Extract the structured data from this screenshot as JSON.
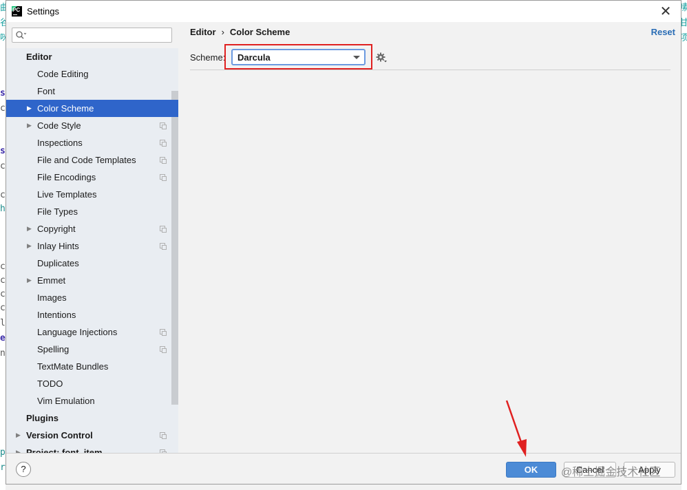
{
  "window": {
    "title": "Settings"
  },
  "sidebar": {
    "search_placeholder": "",
    "items": [
      {
        "label": "Editor",
        "level": 0,
        "bold": true,
        "arrow": false,
        "copy": false,
        "selected": false
      },
      {
        "label": "Code Editing",
        "level": 1,
        "arrow": false,
        "copy": false,
        "selected": false
      },
      {
        "label": "Font",
        "level": 1,
        "arrow": false,
        "copy": false,
        "selected": false
      },
      {
        "label": "Color Scheme",
        "level": 1,
        "arrow": true,
        "copy": false,
        "selected": true
      },
      {
        "label": "Code Style",
        "level": 1,
        "arrow": true,
        "copy": true,
        "selected": false
      },
      {
        "label": "Inspections",
        "level": 1,
        "arrow": false,
        "copy": true,
        "selected": false
      },
      {
        "label": "File and Code Templates",
        "level": 1,
        "arrow": false,
        "copy": true,
        "selected": false
      },
      {
        "label": "File Encodings",
        "level": 1,
        "arrow": false,
        "copy": true,
        "selected": false
      },
      {
        "label": "Live Templates",
        "level": 1,
        "arrow": false,
        "copy": false,
        "selected": false
      },
      {
        "label": "File Types",
        "level": 1,
        "arrow": false,
        "copy": false,
        "selected": false
      },
      {
        "label": "Copyright",
        "level": 1,
        "arrow": true,
        "copy": true,
        "selected": false
      },
      {
        "label": "Inlay Hints",
        "level": 1,
        "arrow": true,
        "copy": true,
        "selected": false
      },
      {
        "label": "Duplicates",
        "level": 1,
        "arrow": false,
        "copy": false,
        "selected": false
      },
      {
        "label": "Emmet",
        "level": 1,
        "arrow": true,
        "copy": false,
        "selected": false
      },
      {
        "label": "Images",
        "level": 1,
        "arrow": false,
        "copy": false,
        "selected": false
      },
      {
        "label": "Intentions",
        "level": 1,
        "arrow": false,
        "copy": false,
        "selected": false
      },
      {
        "label": "Language Injections",
        "level": 1,
        "arrow": false,
        "copy": true,
        "selected": false
      },
      {
        "label": "Spelling",
        "level": 1,
        "arrow": false,
        "copy": true,
        "selected": false
      },
      {
        "label": "TextMate Bundles",
        "level": 1,
        "arrow": false,
        "copy": false,
        "selected": false
      },
      {
        "label": "TODO",
        "level": 1,
        "arrow": false,
        "copy": false,
        "selected": false
      },
      {
        "label": "Vim Emulation",
        "level": 1,
        "arrow": false,
        "copy": false,
        "selected": false
      },
      {
        "label": "Plugins",
        "level": 0,
        "bold": true,
        "arrow": false,
        "copy": false,
        "selected": false
      },
      {
        "label": "Version Control",
        "level": 0,
        "bold": true,
        "arrow": true,
        "copy": true,
        "selected": false
      },
      {
        "label": "Project: font_item",
        "level": 0,
        "bold": true,
        "arrow": true,
        "copy": true,
        "selected": false
      }
    ]
  },
  "content": {
    "breadcrumb": [
      "Editor",
      "Color Scheme"
    ],
    "breadcrumb_sep": "›",
    "reset_label": "Reset",
    "scheme_label": "Scheme:",
    "scheme_value": "Darcula"
  },
  "footer": {
    "help_label": "?",
    "ok_label": "OK",
    "cancel_label": "Cancel",
    "apply_label": "Apply",
    "watermark": "@稀土掘金技术社区"
  },
  "icons": {
    "app": "pycharm-icon",
    "close": "close-icon",
    "search": "search-icon",
    "gear": "gear-icon",
    "expand": "chevron-right-icon",
    "copy": "copy-icon"
  },
  "colors": {
    "selection": "#2f65ca",
    "ok_button": "#4c8bd6",
    "link": "#2a6db5",
    "annotation": "#e02020"
  }
}
